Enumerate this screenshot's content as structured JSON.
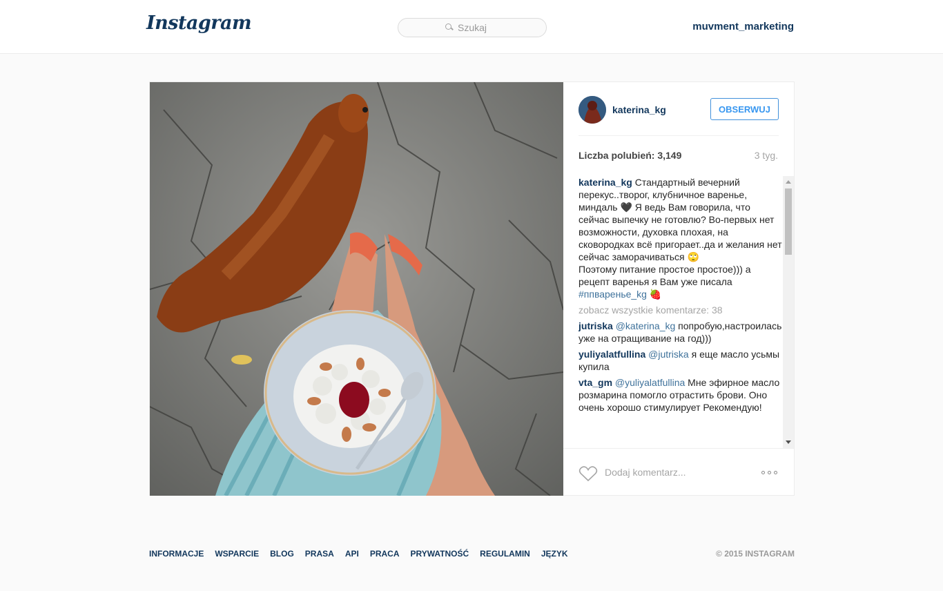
{
  "header": {
    "logo_text": "Instagram",
    "search_placeholder": "Szukaj",
    "username": "muvment_marketing"
  },
  "post": {
    "image_icon": "photo-dog-plate-icon",
    "owner": "katerina_kg",
    "follow_label": "OBSERWUJ",
    "likes": "Liczba polubień: 3,149",
    "time_ago": "3 tyg.",
    "caption": {
      "user": "katerina_kg",
      "text_part1": " Стандартный вечерний перекус..творог, клубничное варенье, миндаль 🖤 Я ведь Вам говорила, что сейчас выпечку не готовлю? Во-первых нет возможности, духовка плохая, на сковородках всё пригорает..да и желания нет сейчас заморачиваться 🙄",
      "text_part2": "Поэтому питание простое простое))) а рецепт варенья я Вам уже писала ",
      "hashtag": "#ппваренье_kg",
      "emoji_end": " 🍓"
    },
    "view_all": "zobacz wszystkie komentarze: 38",
    "comments": [
      {
        "user": "jutriska",
        "mention": "@katerina_kg",
        "text": " попробую,настроилась уже на отращивание на год)))"
      },
      {
        "user": "yuliyalatfullina",
        "mention": "@jutriska",
        "text": " я еще масло усьмы купила"
      },
      {
        "user": "vta_gm",
        "mention": "@yuliyalatfullina",
        "text": " Мне эфирное масло розмарина помогло отрастить брови. Оно очень хорошо стимулирует Рекомендую!"
      }
    ],
    "add_comment_placeholder": "Dodaj komentarz...",
    "colors": {
      "accent": "#3897f0",
      "link": "#12375c"
    }
  },
  "footer": {
    "links": [
      "INFORMACJE",
      "WSPARCIE",
      "BLOG",
      "PRASA",
      "API",
      "PRACA",
      "PRYWATNOŚĆ",
      "REGULAMIN",
      "JĘZYK"
    ],
    "copyright": "© 2015 INSTAGRAM"
  }
}
